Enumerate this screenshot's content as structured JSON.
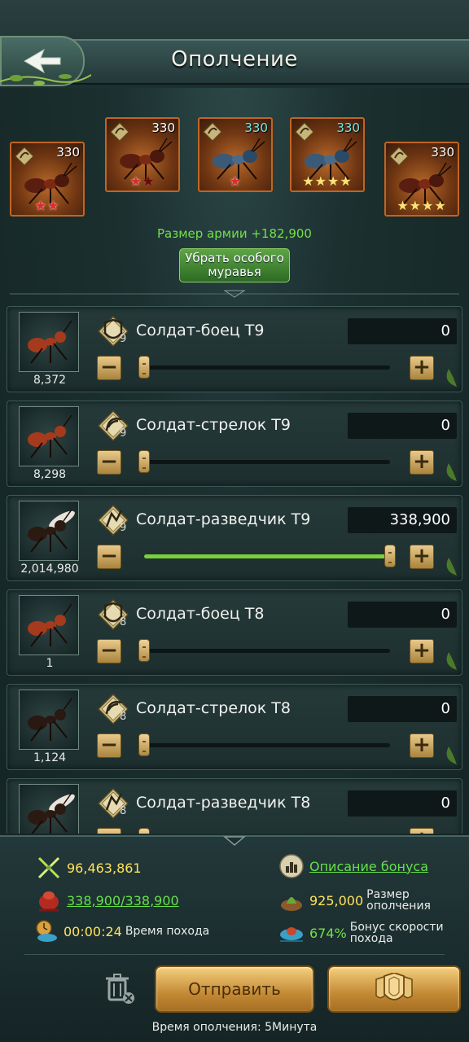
{
  "header": {
    "title": "Ополчение"
  },
  "special_ants": [
    {
      "level": "330",
      "stars": [
        "red",
        "red"
      ],
      "color": "#c06524"
    },
    {
      "level": "330",
      "stars": [
        "red",
        "dark"
      ],
      "color": "#c06524"
    },
    {
      "level": "330",
      "stars": [
        "red"
      ],
      "color": "#c06524"
    },
    {
      "level": "330",
      "stars": [
        "gold",
        "gold",
        "gold",
        "gold"
      ],
      "color": "#c06524"
    },
    {
      "level": "330",
      "stars": [
        "gold",
        "gold",
        "gold",
        "gold-half"
      ],
      "color": "#c06524"
    }
  ],
  "army_size_text": "Размер армии +182,900",
  "remove_button": {
    "line1": "Убрать особого",
    "line2": "муравья"
  },
  "troops": [
    {
      "name": "Солдат-боец T9",
      "tier": "9",
      "count": "8,372",
      "quantity": "0",
      "slider_fraction": 0.0,
      "icon": "shield-icon"
    },
    {
      "name": "Солдат-стрелок T9",
      "tier": "9",
      "count": "8,298",
      "quantity": "0",
      "slider_fraction": 0.0,
      "icon": "bow-icon"
    },
    {
      "name": "Солдат-разведчик T9",
      "tier": "9",
      "count": "2,014,980",
      "quantity": "338,900",
      "slider_fraction": 1.0,
      "icon": "scout-icon"
    },
    {
      "name": "Солдат-боец T8",
      "tier": "8",
      "count": "1",
      "quantity": "0",
      "slider_fraction": 0.0,
      "icon": "shield-icon"
    },
    {
      "name": "Солдат-стрелок T8",
      "tier": "8",
      "count": "1,124",
      "quantity": "0",
      "slider_fraction": 0.0,
      "icon": "bow-icon"
    },
    {
      "name": "Солдат-разведчик T8",
      "tier": "8",
      "count": "",
      "quantity": "0",
      "slider_fraction": 0.0,
      "icon": "scout-icon"
    }
  ],
  "bottom": {
    "power": "96,463,861",
    "troops_selected": "338,900/338,900",
    "march_time": "00:00:24",
    "march_time_label": "Время похода",
    "bonus_link": "Описание бонуса",
    "militia_size_value": "925,000",
    "militia_size_label_1": "Размер",
    "militia_size_label_2": "ополчения",
    "speed_bonus_value": "674%",
    "speed_bonus_label_1": "Бонус скорости",
    "speed_bonus_label_2": "похода",
    "send_label": "Отправить",
    "muster_time": "Время ополчения: 5Минута"
  },
  "colors": {
    "accent_green": "#72e04a",
    "gold": "#ffe35a",
    "button_gold": "#c48a35"
  }
}
